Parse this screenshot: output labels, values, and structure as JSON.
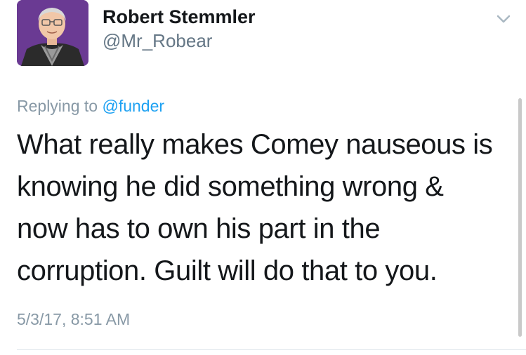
{
  "tweet": {
    "author_name": "Robert Stemmler",
    "author_handle": "@Mr_Robear",
    "reply_prefix": "Replying to",
    "reply_mention": "@funder",
    "text_lines": [
      "What really makes Comey nauseous is",
      "knowing he did something wrong &",
      "now has to own his part in the",
      "corruption. Guilt will do that to you."
    ],
    "timestamp": "5/3/17, 8:51 AM"
  },
  "icons": {
    "menu": "chevron-down-icon",
    "avatar": "avatar"
  },
  "colors": {
    "avatar_bg": "#6a3a93",
    "mention": "#1da1f2",
    "secondary_text": "#8899a6"
  }
}
